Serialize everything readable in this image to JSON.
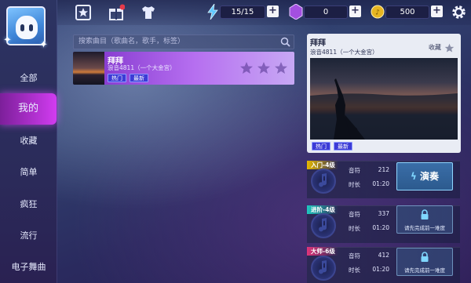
{
  "sidebar": {
    "items": [
      {
        "label": "全部"
      },
      {
        "label": "我的"
      },
      {
        "label": "收藏"
      },
      {
        "label": "简单"
      },
      {
        "label": "疯狂"
      },
      {
        "label": "流行"
      },
      {
        "label": "电子舞曲"
      }
    ],
    "active_index": 1
  },
  "topbar": {
    "icons": [
      "star-icon",
      "gift-icon",
      "shirt-icon"
    ],
    "energy": {
      "value": "15/15",
      "icon": "lightning-icon"
    },
    "gems": {
      "value": "0",
      "icon": "gem-icon"
    },
    "coins": {
      "value": "500",
      "icon": "coin-icon"
    },
    "settings_icon": "gear-icon"
  },
  "search": {
    "placeholder": "搜索曲目（歌曲名，歌手，标签）"
  },
  "song_list": [
    {
      "title": "拜拜",
      "subtitle": "浪音4811（一个大金宫）",
      "tags": [
        "热门",
        "最新"
      ],
      "rating": 0,
      "max_rating": 3
    }
  ],
  "detail": {
    "title": "拜拜",
    "subtitle": "浪音4811（一个大金宫）",
    "favorite_label": "收藏",
    "tags": [
      "热门",
      "最新"
    ]
  },
  "levels": [
    {
      "badge": "入门-4级",
      "badge_color": "#e6b800",
      "notes_label": "音符",
      "notes": "212",
      "duration_label": "时长",
      "duration": "01:20",
      "action": "演奏",
      "locked": false
    },
    {
      "badge": "进阶-4级",
      "badge_color": "#1fc8c0",
      "notes_label": "音符",
      "notes": "337",
      "duration_label": "时长",
      "duration": "01:20",
      "action": "请先完成前一难度",
      "locked": true
    },
    {
      "badge": "大师-6级",
      "badge_color": "#e0357a",
      "notes_label": "音符",
      "notes": "412",
      "duration_label": "时长",
      "duration": "01:20",
      "action": "请先完成前一难度",
      "locked": true
    }
  ],
  "colors": {
    "accent": "#c23de6",
    "tag": "#3c3bd6",
    "panel": "#e9ecf4"
  }
}
